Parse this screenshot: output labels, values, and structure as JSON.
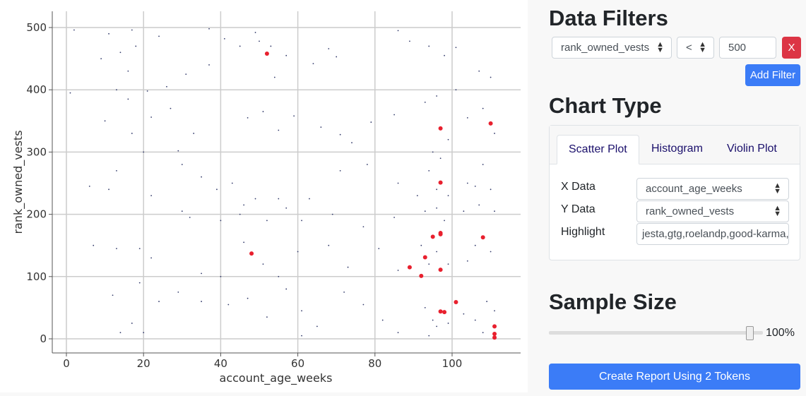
{
  "chart_data": {
    "type": "scatter",
    "xlabel": "account_age_weeks",
    "ylabel": "rank_owned_vests",
    "xlim": [
      -4,
      118
    ],
    "ylim": [
      -22,
      525
    ],
    "xticks": [
      0,
      20,
      40,
      60,
      80,
      100
    ],
    "yticks": [
      0,
      100,
      200,
      300,
      400,
      500
    ],
    "grid": true,
    "highlight_color": "#e8202e",
    "point_color": "#333b6b",
    "highlighted": [
      [
        52,
        458
      ],
      [
        110,
        346
      ],
      [
        97,
        338
      ],
      [
        97,
        251
      ],
      [
        95,
        164
      ],
      [
        97,
        170
      ],
      [
        97,
        168
      ],
      [
        108,
        163
      ],
      [
        93,
        131
      ],
      [
        89,
        115
      ],
      [
        97,
        111
      ],
      [
        92,
        101
      ],
      [
        101,
        59
      ],
      [
        97,
        44
      ],
      [
        98,
        43
      ],
      [
        48,
        137
      ],
      [
        111,
        20
      ],
      [
        111,
        8
      ],
      [
        111,
        2
      ]
    ],
    "points": [
      [
        2,
        496
      ],
      [
        11,
        490
      ],
      [
        17,
        496
      ],
      [
        18,
        470
      ],
      [
        14,
        460
      ],
      [
        9,
        450
      ],
      [
        16,
        430
      ],
      [
        24,
        486
      ],
      [
        26,
        405
      ],
      [
        31,
        425
      ],
      [
        37,
        498
      ],
      [
        37,
        440
      ],
      [
        41,
        482
      ],
      [
        45,
        470
      ],
      [
        49,
        492
      ],
      [
        50,
        478
      ],
      [
        53,
        470
      ],
      [
        54,
        420
      ],
      [
        57,
        455
      ],
      [
        64,
        442
      ],
      [
        68,
        466
      ],
      [
        70,
        453
      ],
      [
        86,
        495
      ],
      [
        89,
        478
      ],
      [
        94,
        470
      ],
      [
        98,
        455
      ],
      [
        101,
        468
      ],
      [
        107,
        430
      ],
      [
        110,
        420
      ],
      [
        1,
        395
      ],
      [
        13,
        400
      ],
      [
        16,
        385
      ],
      [
        21,
        398
      ],
      [
        22,
        356
      ],
      [
        27,
        370
      ],
      [
        10,
        350
      ],
      [
        17,
        330
      ],
      [
        20,
        300
      ],
      [
        29,
        302
      ],
      [
        33,
        330
      ],
      [
        47,
        355
      ],
      [
        51,
        365
      ],
      [
        55,
        335
      ],
      [
        59,
        358
      ],
      [
        66,
        340
      ],
      [
        71,
        328
      ],
      [
        74,
        315
      ],
      [
        79,
        348
      ],
      [
        85,
        360
      ],
      [
        93,
        380
      ],
      [
        96,
        390
      ],
      [
        101,
        400
      ],
      [
        104,
        355
      ],
      [
        108,
        370
      ],
      [
        111,
        330
      ],
      [
        95,
        300
      ],
      [
        97,
        290
      ],
      [
        99,
        320
      ],
      [
        6,
        245
      ],
      [
        11,
        240
      ],
      [
        13,
        270
      ],
      [
        22,
        230
      ],
      [
        30,
        280
      ],
      [
        35,
        260
      ],
      [
        39,
        240
      ],
      [
        43,
        250
      ],
      [
        46,
        215
      ],
      [
        49,
        225
      ],
      [
        55,
        225
      ],
      [
        63,
        225
      ],
      [
        71,
        270
      ],
      [
        78,
        280
      ],
      [
        86,
        250
      ],
      [
        91,
        230
      ],
      [
        94,
        270
      ],
      [
        96,
        240
      ],
      [
        99,
        230
      ],
      [
        104,
        250
      ],
      [
        106,
        245
      ],
      [
        108,
        280
      ],
      [
        110,
        240
      ],
      [
        32,
        195
      ],
      [
        30,
        205
      ],
      [
        40,
        190
      ],
      [
        45,
        200
      ],
      [
        52,
        190
      ],
      [
        57,
        210
      ],
      [
        61,
        190
      ],
      [
        69,
        200
      ],
      [
        77,
        180
      ],
      [
        85,
        195
      ],
      [
        93,
        205
      ],
      [
        96,
        210
      ],
      [
        98,
        190
      ],
      [
        103,
        205
      ],
      [
        107,
        215
      ],
      [
        111,
        205
      ],
      [
        7,
        150
      ],
      [
        13,
        145
      ],
      [
        19,
        145
      ],
      [
        22,
        130
      ],
      [
        35,
        105
      ],
      [
        40,
        100
      ],
      [
        46,
        155
      ],
      [
        51,
        120
      ],
      [
        55,
        100
      ],
      [
        60,
        140
      ],
      [
        68,
        150
      ],
      [
        73,
        115
      ],
      [
        81,
        145
      ],
      [
        86,
        110
      ],
      [
        92,
        150
      ],
      [
        94,
        120
      ],
      [
        96,
        140
      ],
      [
        99,
        120
      ],
      [
        104,
        125
      ],
      [
        106,
        150
      ],
      [
        110,
        140
      ],
      [
        12,
        70
      ],
      [
        19,
        90
      ],
      [
        24,
        60
      ],
      [
        29,
        75
      ],
      [
        35,
        60
      ],
      [
        42,
        55
      ],
      [
        47,
        65
      ],
      [
        52,
        35
      ],
      [
        57,
        80
      ],
      [
        61,
        45
      ],
      [
        65,
        20
      ],
      [
        72,
        75
      ],
      [
        77,
        55
      ],
      [
        82,
        30
      ],
      [
        86,
        10
      ],
      [
        93,
        50
      ],
      [
        95,
        30
      ],
      [
        96,
        20
      ],
      [
        99,
        25
      ],
      [
        103,
        40
      ],
      [
        106,
        30
      ],
      [
        109,
        60
      ],
      [
        111,
        45
      ],
      [
        17,
        25
      ],
      [
        20,
        10
      ],
      [
        14,
        10
      ],
      [
        61,
        5
      ],
      [
        94,
        5
      ],
      [
        108,
        10
      ]
    ]
  },
  "filters": {
    "heading": "Data Filters",
    "field": "rank_owned_vests",
    "operator": "<",
    "value": "500",
    "remove_label": "X",
    "add_label": "Add Filter"
  },
  "chart_type": {
    "heading": "Chart Type",
    "tabs": [
      "Scatter Plot",
      "Histogram",
      "Violin Plot"
    ],
    "active_tab": "Scatter Plot",
    "x_label": "X Data",
    "x_value": "account_age_weeks",
    "y_label": "Y Data",
    "y_value": "rank_owned_vests",
    "highlight_label": "Highlight",
    "highlight_value": "jesta,gtg,roelandp,good-karma,t"
  },
  "sample": {
    "heading": "Sample Size",
    "percent": 100,
    "percent_label": "100%"
  },
  "report_button": "Create Report Using 2 Tokens",
  "colors": {
    "primary": "#3b7cf7",
    "danger": "#dc3545"
  }
}
